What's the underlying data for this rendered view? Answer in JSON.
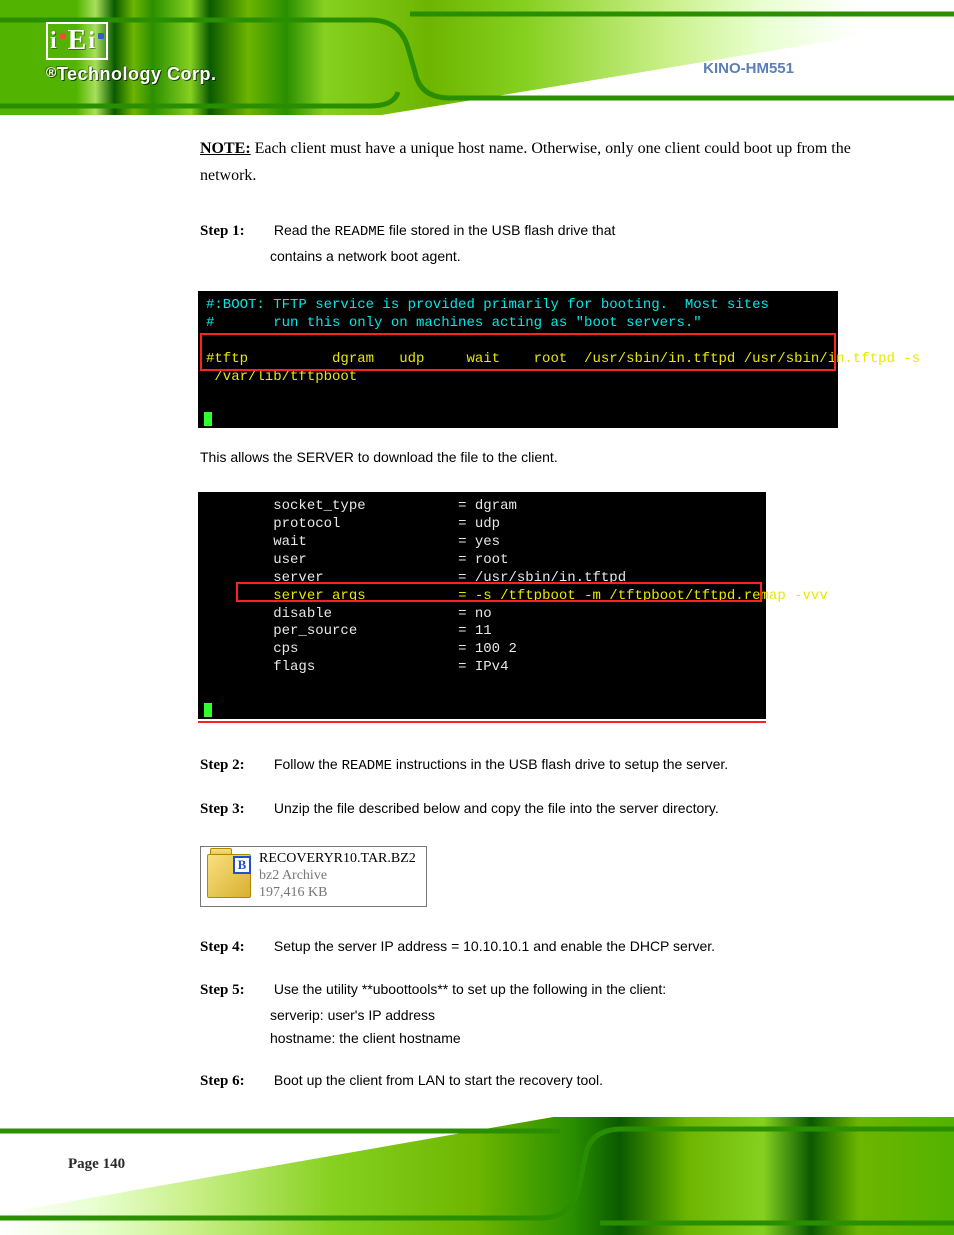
{
  "header": {
    "logo_reg": "®",
    "logo_text": "Technology Corp.",
    "doc_title": "KINO-HM551"
  },
  "note": {
    "label": "NOTE:",
    "text": "Each client must have a unique host name. Otherwise, only one client could boot up from the network."
  },
  "step1": {
    "num": "Step 1:",
    "text_a": "Read the ",
    "text_b": " file stored in the USB flash drive that",
    "text_c": "contains a network boot agent.",
    "readme_code": "README"
  },
  "term1": {
    "line1": "#:BOOT: TFTP service is provided primarily for booting.  Most sites",
    "line2": "#       run this only on machines acting as \"boot servers.\"",
    "line3": "#tftp          dgram   udp     wait    root  /usr/sbin/in.tftpd /usr/sbin/in.tftpd -s",
    "line4": " /var/lib/tftpboot"
  },
  "mid_text": "This allows the SERVER to download the file to the client.",
  "term2": {
    "r1k": "socket_type",
    "r1v": "= dgram",
    "r2k": "protocol",
    "r2v": "= udp",
    "r3k": "wait",
    "r3v": "= yes",
    "r4k": "user",
    "r4v": "= root",
    "r5k": "server",
    "r5v": "= /usr/sbin/in.tftpd",
    "r6k": "server_args",
    "r6v": "= -s /tftpboot -m /tftpboot/tftpd.remap -vvv",
    "r7k": "disable",
    "r7v": "= no",
    "r8k": "per_source",
    "r8v": "= 11",
    "r9k": "cps",
    "r9v": "= 100 2",
    "r10k": "flags",
    "r10v": "= IPv4"
  },
  "step2": {
    "num": "Step 2:",
    "text_a": "Follow the ",
    "text_b": " instructions in the USB flash drive to setup the server.",
    "readme_code": "README"
  },
  "step3": {
    "num": "Step 3:",
    "text": "Unzip the file described below and copy the file into the server directory."
  },
  "file": {
    "badge_letter": "B",
    "name": "RECOVERYR10.TAR.BZ2",
    "type": "bz2 Archive",
    "size": "197,416 KB"
  },
  "step4": {
    "num": "Step 4:",
    "text": "Setup the server IP address = 10.10.10.1 and enable the DHCP server."
  },
  "step5": {
    "num": "Step 5:",
    "text_a": "Use the utility **uboottools** to set up the following in the client:",
    "text_b": "serverip: user's IP address",
    "text_c": "hostname: the client hostname"
  },
  "step6": {
    "num": "Step 6:",
    "text": "Boot up the client from LAN to start the recovery tool."
  },
  "footer": {
    "page": "Page 140"
  }
}
